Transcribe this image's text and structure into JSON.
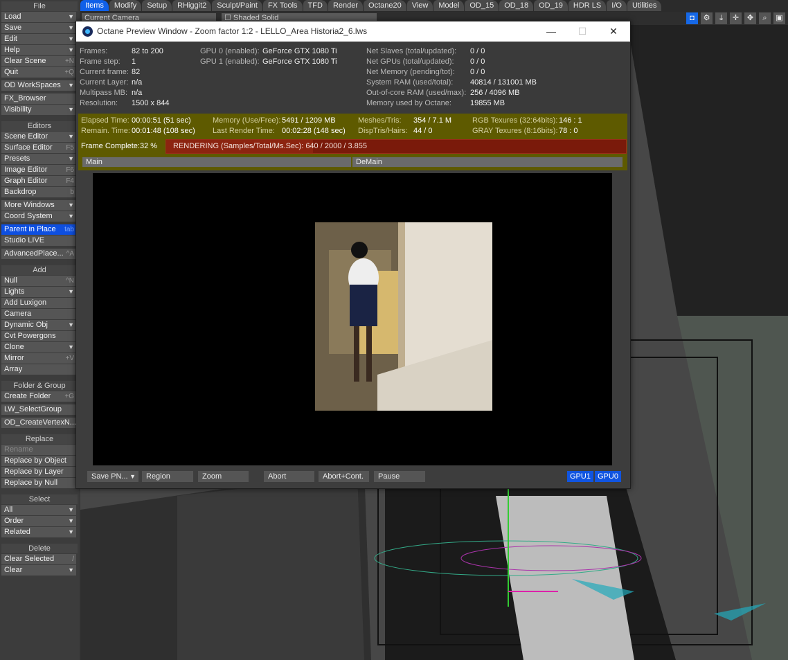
{
  "tabs": [
    "Items",
    "Modify",
    "Setup",
    "RHiggit2",
    "Sculpt/Paint",
    "FX Tools",
    "TFD",
    "Render",
    "Octane20",
    "View",
    "Model",
    "OD_15",
    "OD_18",
    "OD_19",
    "HDR LS",
    "I/O",
    "Utilities"
  ],
  "subbar": {
    "camera_select": "Current Camera",
    "shading_select": "Shaded Solid"
  },
  "left": {
    "file_header": "File",
    "load": "Load",
    "save": "Save",
    "edit": "Edit",
    "help": "Help",
    "clear_scene": "Clear Scene",
    "clear_scene_sc": "+N",
    "quit": "Quit",
    "quit_sc": "+Q",
    "od_workspaces": "OD WorkSpaces",
    "fx_browser": "FX_Browser",
    "visibility": "Visibility",
    "editors_header": "Editors",
    "scene_editor": "Scene Editor",
    "surface_editor": "Surface Editor",
    "surface_editor_sc": "F5",
    "presets": "Presets",
    "image_editor": "Image Editor",
    "image_editor_sc": "F6",
    "graph_editor": "Graph Editor",
    "graph_editor_sc": "F4",
    "backdrop": "Backdrop",
    "backdrop_sc": "b",
    "more_windows": "More Windows",
    "coord_system": "Coord System",
    "parent_in_place": "Parent in Place",
    "parent_in_place_sc": "tab",
    "studio_live": "Studio LIVE",
    "advanced_place": "AdvancedPlace...",
    "advanced_place_sc": "^A",
    "add_header": "Add",
    "null": "Null",
    "null_sc": "^N",
    "lights": "Lights",
    "add_luxigon": "Add Luxigon",
    "camera": "Camera",
    "dynamic_obj": "Dynamic Obj",
    "cvt_powergons": "Cvt Powergons",
    "clone": "Clone",
    "mirror": "Mirror",
    "mirror_sc": "+V",
    "array": "Array",
    "folder_group_header": "Folder & Group",
    "create_folder": "Create Folder",
    "create_folder_sc": "+G",
    "lw_selectgroup": "LW_SelectGroup",
    "od_createvertex": "OD_CreateVertexN...",
    "replace_header": "Replace",
    "rename": "Rename",
    "replace_by_object": "Replace by Object",
    "replace_by_layer": "Replace by Layer",
    "replace_by_null": "Replace by Null",
    "select_header": "Select",
    "all": "All",
    "order": "Order",
    "related": "Related",
    "delete_header": "Delete",
    "clear_selected": "Clear Selected",
    "clear_selected_sc": "/",
    "clear": "Clear"
  },
  "octane": {
    "title": "Octane Preview Window - Zoom factor 1:2 - LELLO_Area Historia2_6.lws",
    "info": {
      "frames_l": "Frames:",
      "frames_v": "82 to 200",
      "step_l": "Frame step:",
      "step_v": "1",
      "current_l": "Current frame:",
      "current_v": "82",
      "layer_l": "Current Layer:",
      "layer_v": "n/a",
      "multipass_l": "Multipass MB:",
      "multipass_v": "n/a",
      "res_l": "Resolution:",
      "res_v": "1500 x 844",
      "gpu0_l": "GPU  0 (enabled):",
      "gpu0_v": "GeForce GTX 1080 Ti",
      "gpu1_l": "GPU  1 (enabled):",
      "gpu1_v": "GeForce GTX 1080 Ti",
      "slaves_l": "Net Slaves (total/updated):",
      "slaves_v": "0 / 0",
      "netgpus_l": "Net GPUs (total/updated):",
      "netgpus_v": "0 / 0",
      "netmem_l": "Net Memory (pending/tot):",
      "netmem_v": "0 / 0",
      "sysram_l": "System RAM (used/total):",
      "sysram_v": "40814 / 131001 MB",
      "ooc_l": "Out-of-core RAM (used/max):",
      "ooc_v": "256 / 4096 MB",
      "memoct_l": "Memory used by Octane:",
      "memoct_v": "19855 MB"
    },
    "stats": {
      "elapsed_l": "Elapsed Time:",
      "elapsed_v": "00:00:51 (51 sec)",
      "remain_l": "Remain. Time:",
      "remain_v": "00:01:48 (108 sec)",
      "mem_l": "Memory (Use/Free):",
      "mem_v": "5491 / 1209 MB",
      "last_l": "Last Render Time:",
      "last_v": "00:02:28 (148 sec)",
      "meshes_l": "Meshes/Tris:",
      "meshes_v": "354 / 7.1 M",
      "disp_l": "DispTris/Hairs:",
      "disp_v": "44 / 0",
      "rgb_l": "RGB Texures (32:64bits):",
      "rgb_v": "146 : 1",
      "gray_l": "GRAY Texures (8:16bits):",
      "gray_v": "78 : 0",
      "frame_complete_l": "Frame Complete:",
      "frame_complete_v": "32 %",
      "progress_text": "RENDERING (Samples/Total/Ms.Sec): 640 / 2000 / 3.855",
      "progress_fraction": 0.32,
      "pass_main": "Main",
      "pass_demain": "DeMain"
    },
    "buttons": {
      "save": "Save PN...",
      "region": "Region",
      "zoom": "Zoom",
      "abort": "Abort",
      "abort_cont": "Abort+Cont.",
      "pause": "Pause",
      "gpu1": "GPU1",
      "gpu0": "GPU0"
    }
  }
}
